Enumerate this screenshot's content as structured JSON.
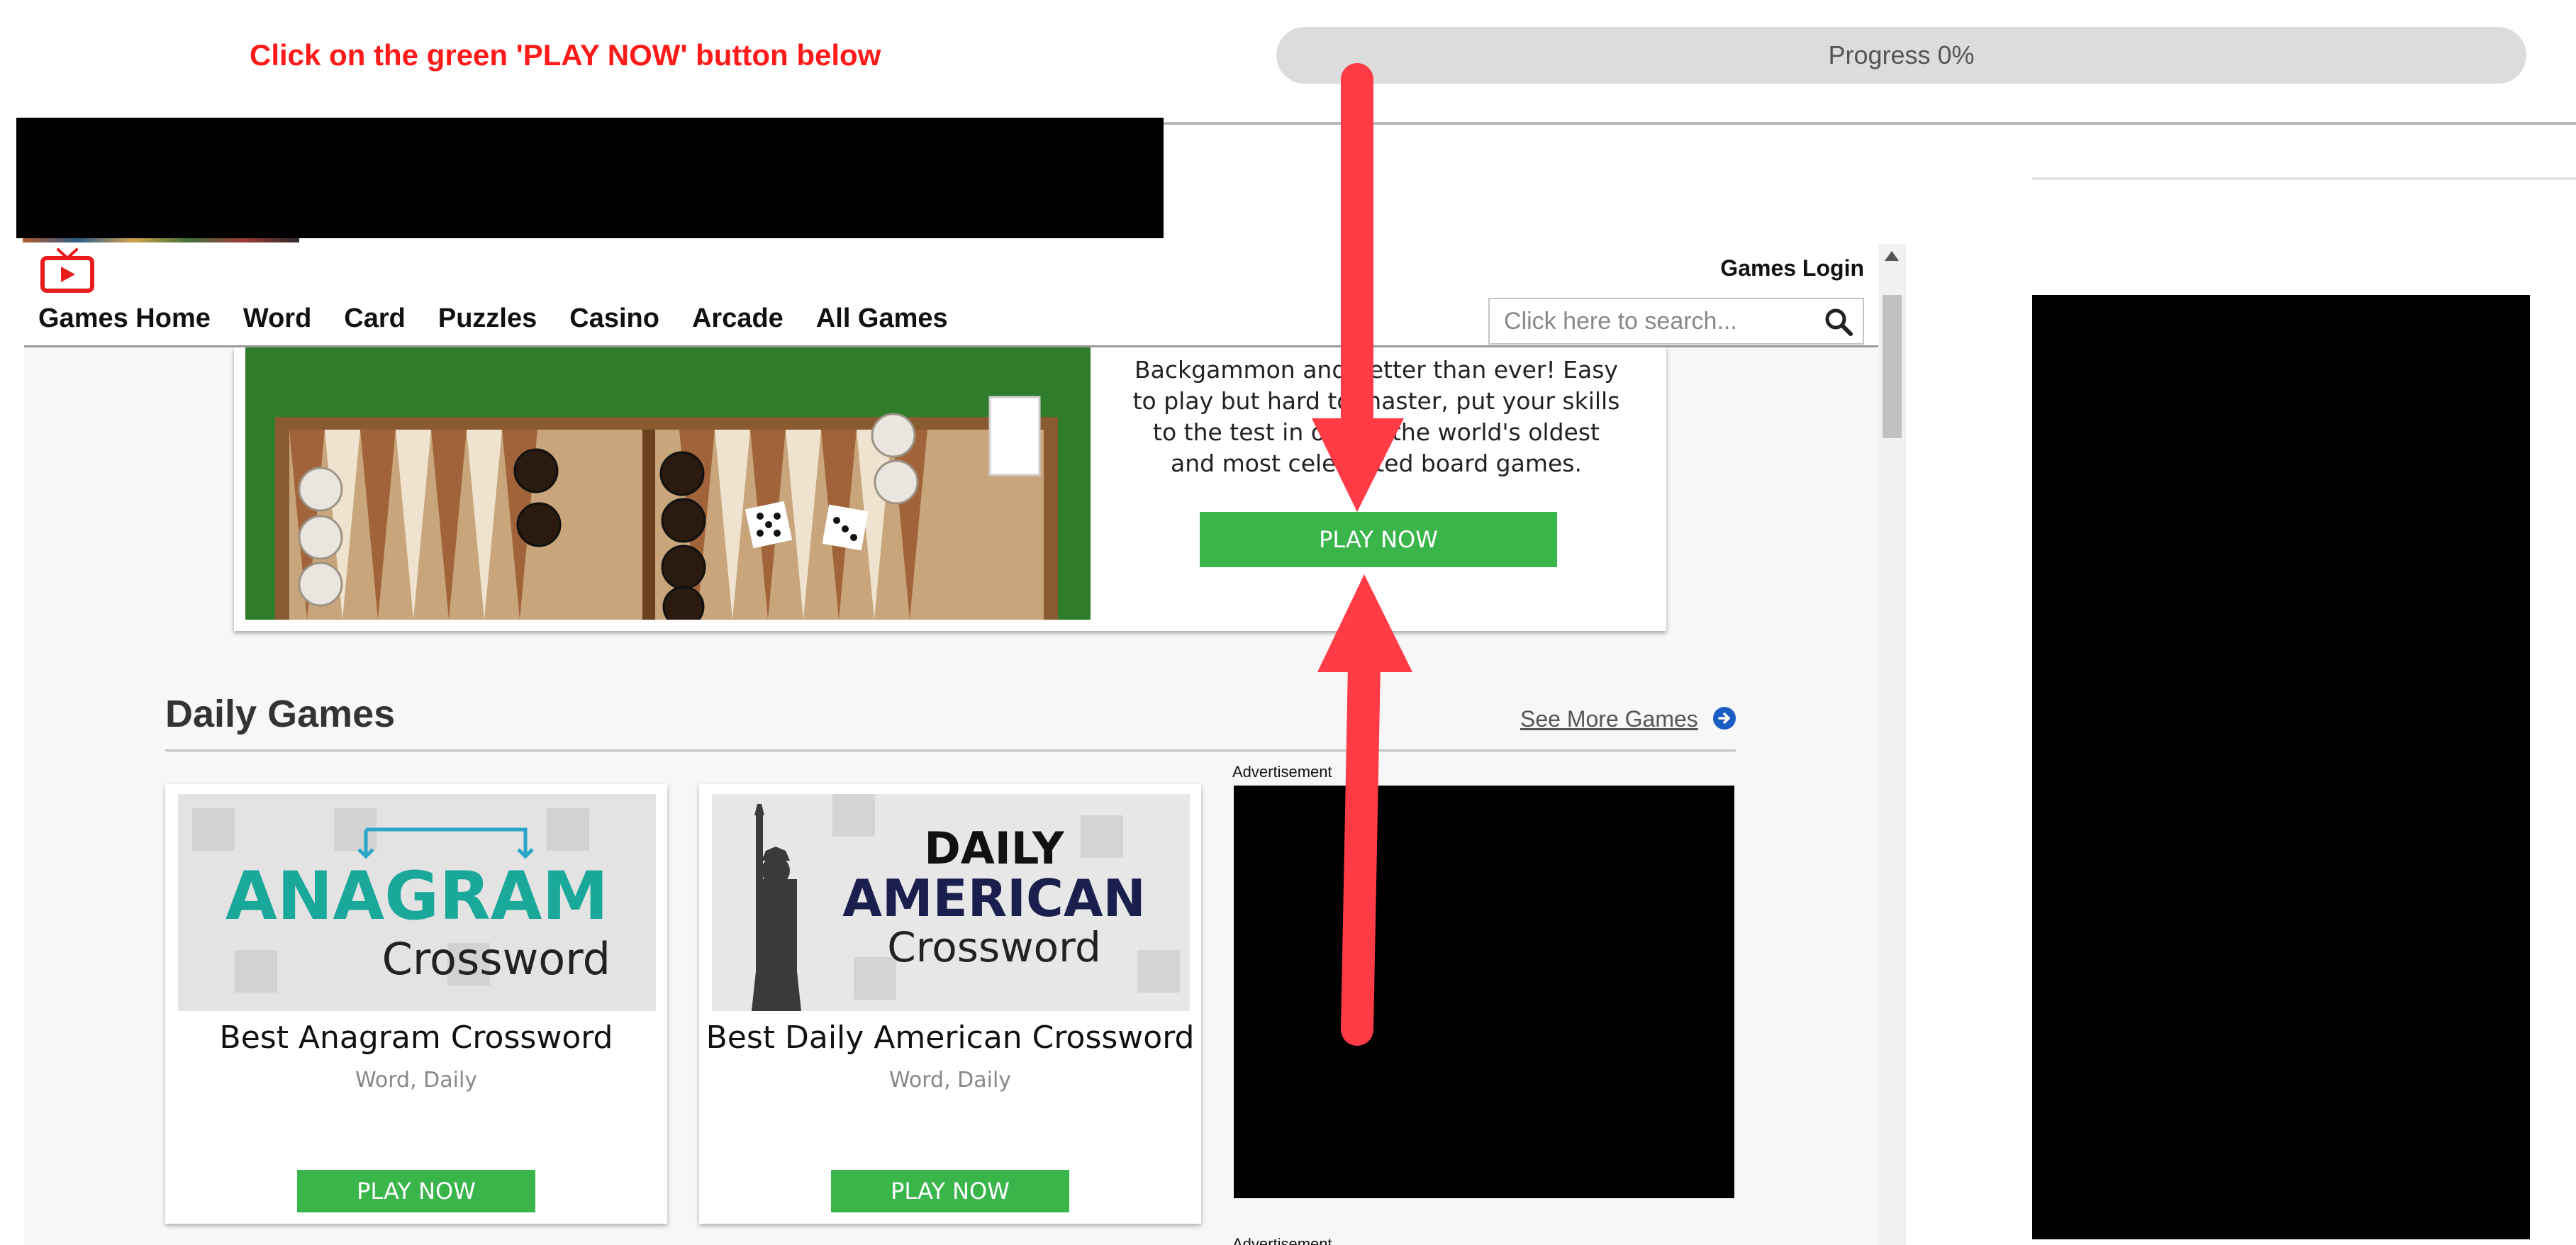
{
  "instruction": {
    "text": "Click on the green 'PLAY NOW' button below"
  },
  "progress": {
    "label": "Progress 0%",
    "value": 0
  },
  "header": {
    "login": "Games Login",
    "nav": [
      "Games Home",
      "Word",
      "Card",
      "Puzzles",
      "Casino",
      "Arcade",
      "All Games"
    ],
    "search_placeholder": "Click here to search..."
  },
  "featured": {
    "description": "Backgammon and better than ever! Easy to play but hard to master, put your skills to the test in one of the world's oldest and most celebrated board games.",
    "play_label": "PLAY NOW"
  },
  "daily": {
    "title": "Daily Games",
    "see_more": "See More Games",
    "games": [
      {
        "title": "Best Anagram Crossword",
        "tags": "Word, Daily",
        "play_label": "PLAY NOW",
        "logo_top": "ANAGRAM",
        "logo_bottom": "Crossword"
      },
      {
        "title": "Best Daily American Crossword",
        "tags": "Word, Daily",
        "play_label": "PLAY NOW",
        "logo_top": "DAILY",
        "logo_mid": "AMERICAN",
        "logo_bottom": "Crossword"
      }
    ],
    "ad_label": "Advertisement",
    "ad_label_2": "Advertisement"
  },
  "colors": {
    "accent_green": "#39b54a",
    "instruction_red": "#ff1a1a",
    "arrow_red": "#ff3b46"
  }
}
